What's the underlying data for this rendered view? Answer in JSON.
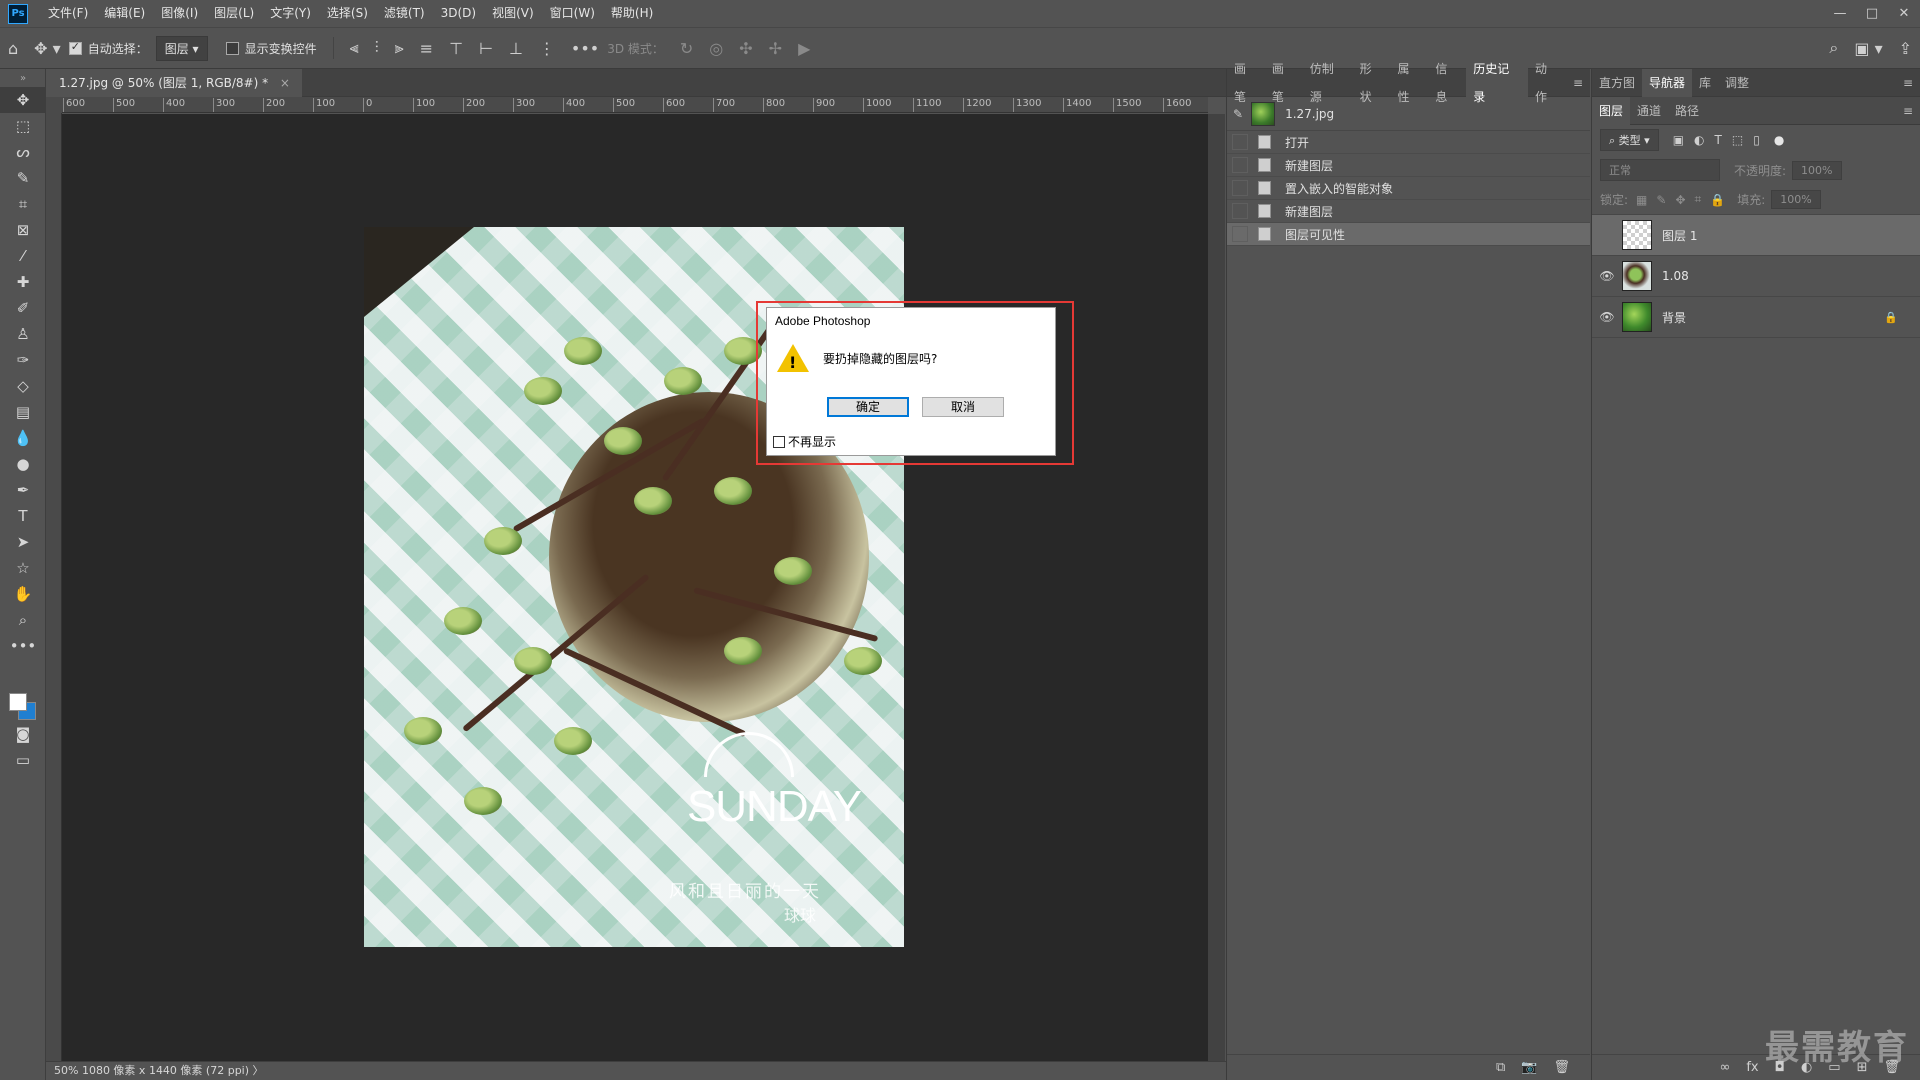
{
  "app": {
    "logo": "Ps"
  },
  "menu": [
    "文件(F)",
    "编辑(E)",
    "图像(I)",
    "图层(L)",
    "文字(Y)",
    "选择(S)",
    "滤镜(T)",
    "3D(D)",
    "视图(V)",
    "窗口(W)",
    "帮助(H)"
  ],
  "window_controls": {
    "minimize": "—",
    "restore": "□",
    "close": "✕"
  },
  "options": {
    "auto_select_label": "自动选择：",
    "auto_select_checked": true,
    "auto_select_value": "图层",
    "show_transform_label": "显示变换控件",
    "mode_3d_label": "3D 模式：",
    "more": "•••"
  },
  "document": {
    "tab_title": "1.27.jpg @ 50% (图层 1, RGB/8#) *",
    "close": "×"
  },
  "ruler": {
    "h_ticks": [
      "600",
      "500",
      "400",
      "300",
      "200",
      "100",
      "0",
      "100",
      "200",
      "300",
      "400",
      "500",
      "600",
      "700",
      "800",
      "900",
      "1000",
      "1100",
      "1200",
      "1300",
      "1400",
      "1500",
      "1600"
    ]
  },
  "photo": {
    "title": "SUNDAY",
    "subtitle": "风和且日丽的一天",
    "signature": "球球"
  },
  "dialog": {
    "title": "Adobe Photoshop",
    "message": "要扔掉隐藏的图层吗?",
    "ok": "确定",
    "cancel": "取消",
    "dont_show": "不再显示",
    "highlight_color": "#e53935"
  },
  "status": {
    "text": "50%   1080 像素 x 1440 像素 (72 ppi)  〉"
  },
  "history_panel": {
    "tabs": [
      "画笔",
      "画笔",
      "仿制源",
      "形状",
      "属性",
      "信息",
      "历史记录",
      "动作"
    ],
    "active_tab": "历史记录",
    "snapshot": "1.27.jpg",
    "items": [
      "打开",
      "新建图层",
      "置入嵌入的智能对象",
      "新建图层",
      "图层可见性"
    ],
    "selected_index": 4
  },
  "right_top_tabs": [
    "直方图",
    "导航器",
    "库",
    "调整"
  ],
  "layers_panel": {
    "tabs": [
      "图层",
      "通道",
      "路径"
    ],
    "filter_label": "类型",
    "blend_mode": "正常",
    "opacity_label": "不透明度:",
    "opacity_value": "100%",
    "lock_label": "锁定:",
    "fill_label": "填充:",
    "fill_value": "100%",
    "layers": [
      {
        "name": "图层 1",
        "visible": false,
        "selected": true
      },
      {
        "name": "1.08",
        "visible": true,
        "selected": false
      },
      {
        "name": "背景",
        "visible": true,
        "selected": false,
        "locked": true
      }
    ]
  },
  "watermark": "最需教育",
  "icons": [
    "home-icon",
    "move-icon",
    "search-icon",
    "workspace-icon",
    "share-icon",
    "warning-icon",
    "eye-icon",
    "lock-icon"
  ]
}
